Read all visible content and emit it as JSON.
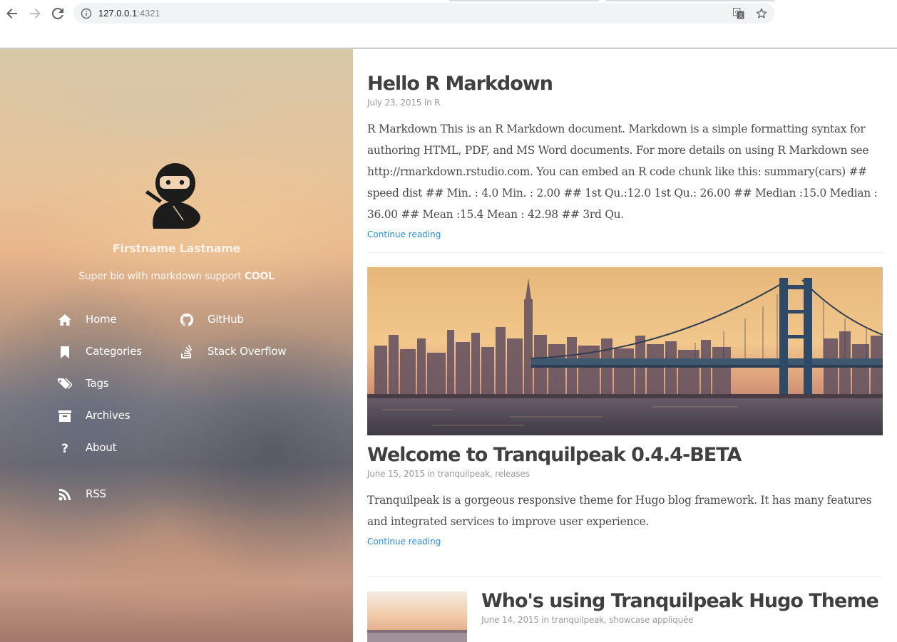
{
  "browser": {
    "url_host": "127.0.0.1",
    "url_port": ":4321",
    "icons": [
      "back-icon",
      "forward-icon",
      "reload-icon",
      "info-icon",
      "translate-icon",
      "star-icon"
    ]
  },
  "sidebar": {
    "author_name": "Firstname Lastname",
    "bio_text": "Super bio with markdown support ",
    "bio_bold": "COOL",
    "menu": [
      {
        "label": "Home",
        "icon": "home-icon"
      },
      {
        "label": "Categories",
        "icon": "bookmark-icon"
      },
      {
        "label": "Tags",
        "icon": "tags-icon"
      },
      {
        "label": "Archives",
        "icon": "archive-icon"
      },
      {
        "label": "About",
        "icon": "question-icon"
      },
      {
        "label": "RSS",
        "icon": "rss-icon"
      }
    ],
    "links": [
      {
        "label": "GitHub",
        "icon": "github-icon"
      },
      {
        "label": "Stack Overflow",
        "icon": "stackoverflow-icon"
      }
    ]
  },
  "posts": [
    {
      "title": "Hello R Markdown",
      "date": "July 23, 2015",
      "in": "in",
      "categories": [
        "R"
      ],
      "excerpt": "R Markdown This is an R Markdown document. Markdown is a simple formatting syntax for authoring HTML, PDF, and MS Word documents. For more details on using R Markdown see http://rmarkdown.rstudio.com. You can embed an R code chunk like this: summary(cars) ## speed dist ## Min. : 4.0 Min. : 2.00 ## 1st Qu.:12.0 1st Qu.: 26.00 ## Median :15.0 Median : 36.00 ## Mean :15.4 Mean : 42.98 ## 3rd Qu.",
      "continue": "Continue reading"
    },
    {
      "title": "Welcome to Tranquilpeak 0.4.4-BETA",
      "date": "June 15, 2015",
      "in": "in",
      "categories": [
        "tranquilpeak",
        "releases"
      ],
      "excerpt": "Tranquilpeak is a gorgeous responsive theme for Hugo blog framework. It has many features and integrated services to improve user experience.",
      "continue": "Continue reading"
    },
    {
      "title": "Who's using Tranquilpeak Hugo Theme",
      "date": "June 14, 2015",
      "in": "in",
      "categories": [
        "tranquilpeak",
        "showcase appliquée"
      ]
    }
  ],
  "colors": {
    "link": "#2f8ccf",
    "title": "#404040",
    "meta": "#9a9a9a"
  }
}
